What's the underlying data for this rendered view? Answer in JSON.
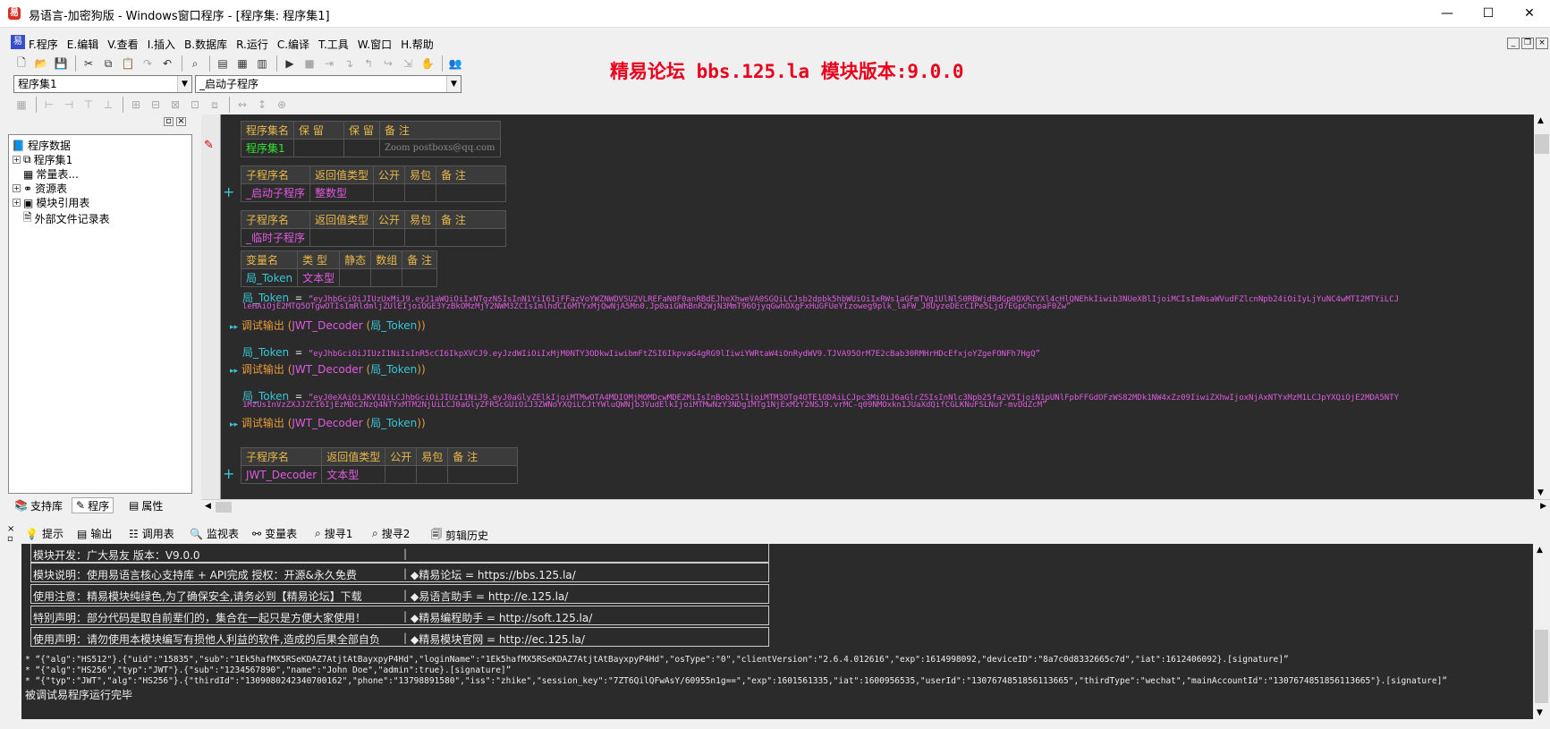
{
  "window": {
    "title": "易语言-加密狗版 - Windows窗口程序 - [程序集: 程序集1]",
    "app_icon": "e-language-icon",
    "minimize": "—",
    "maximize": "☐",
    "close": "✕"
  },
  "menu": {
    "items": [
      "F.程序",
      "E.编辑",
      "V.查看",
      "I.插入",
      "B.数据库",
      "R.运行",
      "C.编译",
      "T.工具",
      "W.窗口",
      "H.帮助"
    ]
  },
  "combos": {
    "module": "程序集1",
    "subprogram": "_启动子程序"
  },
  "banner": "精易论坛 bbs.125.la 模块版本:9.0.0",
  "left_panel": {
    "tree": [
      {
        "label": "程序数据",
        "icon": "book-icon"
      },
      {
        "label": "程序集1",
        "icon": "module-icon"
      },
      {
        "label": "常量表...",
        "icon": "table-icon"
      },
      {
        "label": "资源表",
        "icon": "resource-icon"
      },
      {
        "label": "模块引用表",
        "icon": "module-ref-icon"
      },
      {
        "label": "外部文件记录表",
        "icon": "file-icon"
      }
    ],
    "tabs": [
      "支持库",
      "程序",
      "属性"
    ]
  },
  "editor": {
    "assembly_table": {
      "headers": [
        "程序集名",
        "保 留",
        "保 留",
        "备 注"
      ],
      "row": [
        "程序集1",
        "",
        "",
        "Zoom postboxs@qq.com"
      ]
    },
    "sub1": {
      "headers": [
        "子程序名",
        "返回值类型",
        "公开",
        "易包",
        "备 注"
      ],
      "row": [
        "_启动子程序",
        "整数型",
        "",
        "",
        ""
      ]
    },
    "sub2": {
      "headers": [
        "子程序名",
        "返回值类型",
        "公开",
        "易包",
        "备 注"
      ],
      "row": [
        "_临时子程序",
        "",
        "",
        "",
        ""
      ]
    },
    "vars": {
      "headers": [
        "变量名",
        "类 型",
        "静态",
        "数组",
        "备 注"
      ],
      "row": [
        "局_Token",
        "文本型",
        "",
        "",
        ""
      ]
    },
    "code1": {
      "lhs": "局_Token",
      "eq": " = ",
      "line1": "“eyJhbGciOiJIUzUxMiJ9.eyJ1aWQiOiIxNTgzNSIsInN1YiI6IjFFazVoYWZNWDVSU2VLREFaN0F0anRBdEJheXhweVA0SGQiLCJsb2dpbk5hbWUiOiIxRWs1aGFmTVg1UlNlS0RBWjdBdGp0QXRCYXl4cHlQNEhkIiwib3NUeXBlIjoiMCIsImNsaWVudFZlcnNpb24iOiIyLjYuNC4wMTI2MTYiLCJ",
      "line2": "leHAiOjE2MTQ5OTgwOTIsImRldmljZUlEIjoiOGE3YzBkOMzMjY2NWM3ZCIsImlhdCI6MTYxMjQwNjA5Mn0.Jp0aiGWhBnR2WjN3MmT96OjyqGwhOXgFxHuGFUeYIzoweg9plk_laFW_J8UyzeDEcCIPe5Ljd7EGpChnpaF0Zw”"
    },
    "dbg1": {
      "fn": "调试输出",
      "open": " (",
      "arg1": "JWT_Decoder",
      "open2": " (",
      "arg2": "局_Token",
      "close": "))"
    },
    "code2": {
      "lhs": "局_Token",
      "eq": " = ",
      "line1": "“eyJhbGciOiJIUzI1NiIsInR5cCI6IkpXVCJ9.eyJzdWIiOiIxMjM0NTY3ODkwIiwibmFtZSI6IkpvaG4gRG9lIiwiYWRtaW4iOnRydWV9.TJVA95OrM7E2cBab30RMHrHDcEfxjoYZgeFONFh7HgQ”"
    },
    "dbg2": {
      "fn": "调试输出",
      "open": " (",
      "arg1": "JWT_Decoder",
      "open2": " (",
      "arg2": "局_Token",
      "close": "))"
    },
    "code3": {
      "lhs": "局_Token",
      "eq": " = ",
      "line1": "“eyJ0eXAiOiJKV1QiLCJhbGciOiJIUzI1NiJ9.eyJ0aGlyZElkIjoiMTMwOTA4MDIOMjMOMDcwMDE2MiIsInBob25lIjoiMTM3OTg4OTE1ODAiLCJpc3MiOiJ6aGlrZSIsInNlc3Npb25fa2V5IjoiN1pUNlFpbFFGdOFzWS82MDk1NW4xZz09IiwiZXhwIjoxNjAxNTYxMzM1LCJpYXQiOjE2MDA5NTY",
      "line2": "1MzUsInVzZXJJZCI6IjEzMDc2NzQ4NTYxMTM2NjUiLCJ0aGlyZFR5cGUiOiJ3ZWNoYXQiLCJtYWluQWNjb3VudElkIjoiMTMwNzY3NDg1MTg1NjExMzY2NSJ9.vrMC-q09NMOxkn1JUaXdQifCGLKNuFSLNuf-mvDdZcM”"
    },
    "dbg3": {
      "fn": "调试输出",
      "open": " (",
      "arg1": "JWT_Decoder",
      "open2": " (",
      "arg2": "局_Token",
      "close": "))"
    },
    "sub3": {
      "headers": [
        "子程序名",
        "返回值类型",
        "公开",
        "易包",
        "备 注"
      ],
      "row": [
        "JWT_Decoder",
        "文本型",
        "",
        "",
        ""
      ]
    }
  },
  "bottom_tabs": [
    {
      "label": "提示",
      "icon": "lightbulb-icon"
    },
    {
      "label": "输出",
      "icon": "output-icon"
    },
    {
      "label": "调用表",
      "icon": "callstack-icon"
    },
    {
      "label": "监视表",
      "icon": "magnifier-icon"
    },
    {
      "label": "变量表",
      "icon": "variables-icon"
    },
    {
      "label": "搜寻1",
      "icon": "search-icon"
    },
    {
      "label": "搜寻2",
      "icon": "search-icon"
    },
    {
      "label": "剪辑历史",
      "icon": "clipboard-icon"
    }
  ],
  "output": {
    "rows": [
      {
        "left": "模块开发：广大易友    版本：V9.0.0",
        "right": ""
      },
      {
        "left": "模块说明：使用易语言核心支持库 + API完成      授权：开源&永久免费",
        "right": "◆精易论坛       = https://bbs.125.la/"
      },
      {
        "left": "使用注意：精易模块纯绿色,为了确保安全,请务必到【精易论坛】下载",
        "right": "◆易语言助手     = http://e.125.la/"
      },
      {
        "left": "特别声明：部分代码是取自前辈们的，集合在一起只是方便大家使用！",
        "right": "◆精易编程助手   = http://soft.125.la/"
      },
      {
        "left": "使用声明：请勿使用本模块编写有损他人利益的软件,造成的后果全部自负",
        "right": "◆精易模块官网   = http://ec.125.la/"
      }
    ],
    "lines": [
      "* “{\"alg\":\"HS512\"}.{\"uid\":\"15835\",\"sub\":\"1Ek5hafMX5RSeKDAZ7AtjtAtBayxpyP4Hd\",\"loginName\":\"1Ek5hafMX5RSeKDAZ7AtjtAtBayxpyP4Hd\",\"osType\":\"0\",\"clientVersion\":\"2.6.4.012616\",\"exp\":1614998092,\"deviceID\":\"8a7c0d8332665c7d\",\"iat\":1612406092}.[signature]”",
      "* “{\"alg\":\"HS256\",\"typ\":\"JWT\"}.{\"sub\":\"1234567890\",\"name\":\"John Doe\",\"admin\":true}.[signature]”",
      "* “{\"typ\":\"JWT\",\"alg\":\"HS256\"}.{\"thirdId\":\"1309080242340700162\",\"phone\":\"13798891580\",\"iss\":\"zhike\",\"session_key\":\"7ZT6QilQFwAsY/60955n1g==\",\"exp\":1601561335,\"iat\":1600956535,\"userId\":\"1307674851856113665\",\"thirdType\":\"wechat\",\"mainAccountId\":\"1307674851856113665\"}.[signature]”",
      "被调试易程序运行完毕"
    ]
  }
}
